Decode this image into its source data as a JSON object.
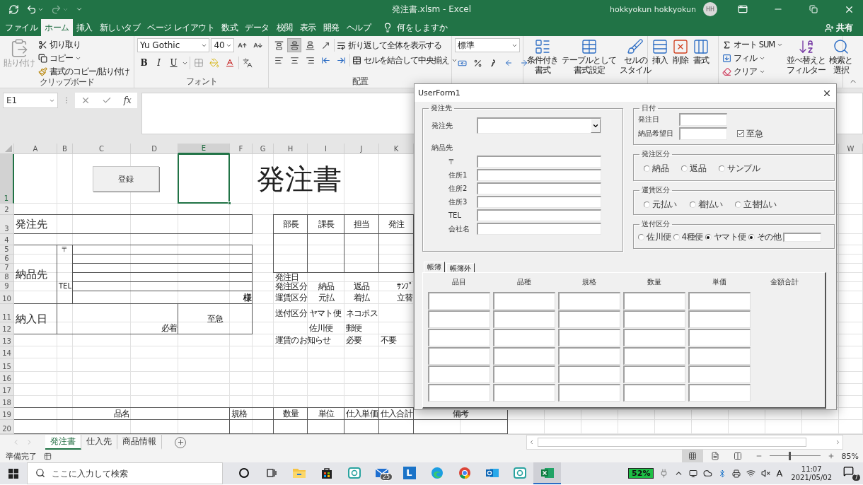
{
  "title_bar": {
    "title": "発注書.xlsm - Excel",
    "user": "hokkyokun hokkyokun",
    "avatar": "HH"
  },
  "tabs": [
    {
      "label": "ファイル",
      "selected": false
    },
    {
      "label": "ホーム",
      "selected": true
    },
    {
      "label": "挿入",
      "selected": false
    },
    {
      "label": "新しいタブ",
      "selected": false
    },
    {
      "label": "ページ レイアウト",
      "selected": false
    },
    {
      "label": "数式",
      "selected": false
    },
    {
      "label": "データ",
      "selected": false
    },
    {
      "label": "校閲",
      "selected": false
    },
    {
      "label": "表示",
      "selected": false
    },
    {
      "label": "開発",
      "selected": false
    },
    {
      "label": "ヘルプ",
      "selected": false
    }
  ],
  "tell_me": "何をしますか",
  "share": "共有",
  "ribbon": {
    "clipboard": {
      "label": "クリップボード",
      "paste": {
        "label": "貼り付け",
        "disabled": true
      },
      "cut": "切り取り",
      "copy": "コピー",
      "format_painter": "書式のコピー/貼り付け"
    },
    "font": {
      "label": "フォント",
      "font_name": "Yu Gothic",
      "font_size": "40",
      "bold": "B",
      "italic": "I",
      "underline": "U"
    },
    "alignment": {
      "label": "配置",
      "vertical": [
        {
          "selected": false
        },
        {
          "selected": true
        },
        {
          "selected": false
        }
      ],
      "wrap_text": "折り返して全体を表示する",
      "merge": "セルを結合して中央揃え"
    },
    "number": {
      "format": "標準"
    },
    "styles": [
      {
        "lines": [
          "条件付き",
          "書式"
        ]
      },
      {
        "lines": [
          "テーブルとして",
          "書式設定"
        ]
      },
      {
        "lines": [
          "セルの",
          "スタイル"
        ]
      }
    ],
    "cells": [
      "挿入",
      "削除",
      "書式"
    ],
    "editing": {
      "autosum": "オート SUM",
      "fill": "フィル",
      "clear": "クリア",
      "sort": [
        "並べ替えと",
        "フィルター"
      ],
      "find": [
        "検索と",
        "選択"
      ]
    }
  },
  "formula_bar": {
    "name_box": "E1",
    "function_label": "fx"
  },
  "sheet": {
    "columns": [
      {
        "label": "A",
        "selected": false
      },
      {
        "label": "B",
        "selected": false
      },
      {
        "label": "C",
        "selected": false
      },
      {
        "label": "D",
        "selected": false
      },
      {
        "label": "E",
        "selected": true
      },
      {
        "label": "F",
        "selected": false
      },
      {
        "label": "G",
        "selected": false
      },
      {
        "label": "H",
        "selected": false
      },
      {
        "label": "I",
        "selected": false
      },
      {
        "label": "J",
        "selected": false
      },
      {
        "label": "K",
        "selected": false
      },
      {
        "label": "W",
        "selected": false
      }
    ],
    "rows": [
      {
        "label": "1",
        "selected": true
      },
      {
        "label": "2",
        "selected": false
      },
      {
        "label": "3",
        "selected": false
      },
      {
        "label": "4",
        "selected": false
      },
      {
        "label": "5",
        "selected": false
      },
      {
        "label": "6",
        "selected": false
      },
      {
        "label": "7",
        "selected": false
      },
      {
        "label": "8",
        "selected": false
      },
      {
        "label": "9",
        "selected": false
      },
      {
        "label": "10",
        "selected": false
      },
      {
        "label": "11",
        "selected": false
      },
      {
        "label": "12",
        "selected": false
      },
      {
        "label": "13",
        "selected": false
      },
      {
        "label": "14",
        "selected": false
      },
      {
        "label": "15",
        "selected": false
      },
      {
        "label": "16",
        "selected": false
      },
      {
        "label": "17",
        "selected": false
      },
      {
        "label": "18",
        "selected": false
      },
      {
        "label": "19",
        "selected": false
      },
      {
        "label": "20",
        "selected": false
      }
    ],
    "sheet_button": "登録",
    "cells": [
      {
        "text": "発注書",
        "kind": "title"
      },
      {
        "text": "発注先",
        "kind": "large"
      },
      {
        "text": "部長",
        "kind": "normal"
      },
      {
        "text": "課長",
        "kind": "normal"
      },
      {
        "text": "担当",
        "kind": "normal"
      },
      {
        "text": "発注",
        "kind": "normal"
      },
      {
        "text": "〒",
        "kind": "small"
      },
      {
        "text": "納品先",
        "kind": "large"
      },
      {
        "text": "発注日",
        "kind": "normal"
      },
      {
        "text": "TEL",
        "kind": "small"
      },
      {
        "text": "発注区分",
        "kind": "normal"
      },
      {
        "text": "納品",
        "kind": "normal"
      },
      {
        "text": "返品",
        "kind": "normal"
      },
      {
        "text": "ｻﾝﾌﾟ",
        "kind": "normal"
      },
      {
        "text": "様",
        "kind": "bold"
      },
      {
        "text": "運賃区分",
        "kind": "normal"
      },
      {
        "text": "元払",
        "kind": "normal"
      },
      {
        "text": "着払",
        "kind": "normal"
      },
      {
        "text": "立替",
        "kind": "normal"
      },
      {
        "text": "納入日",
        "kind": "large"
      },
      {
        "text": "至急",
        "kind": "normal"
      },
      {
        "text": "送付区分",
        "kind": "normal"
      },
      {
        "text": "ヤマト便",
        "kind": "normal"
      },
      {
        "text": "ネコポス",
        "kind": "normal"
      },
      {
        "text": "必着",
        "kind": "normal"
      },
      {
        "text": "佐川便",
        "kind": "normal"
      },
      {
        "text": "郵便",
        "kind": "normal"
      },
      {
        "text": "運賃のお知らせ",
        "kind": "normal"
      },
      {
        "text": "必要",
        "kind": "normal"
      },
      {
        "text": "不要",
        "kind": "normal"
      },
      {
        "text": "品名",
        "kind": "normal"
      },
      {
        "text": "規格",
        "kind": "normal"
      },
      {
        "text": "数量",
        "kind": "normal"
      },
      {
        "text": "単位",
        "kind": "normal"
      },
      {
        "text": "仕入単価",
        "kind": "normal"
      },
      {
        "text": "仕入合計",
        "kind": "normal"
      },
      {
        "text": "備考",
        "kind": "normal"
      }
    ]
  },
  "sheet_tabs": [
    {
      "label": "発注書",
      "selected": true
    },
    {
      "label": "仕入先",
      "selected": false
    },
    {
      "label": "商品情報",
      "selected": false
    }
  ],
  "status_bar": {
    "text": "準備完了",
    "views": [
      {
        "selected": true
      },
      {
        "selected": false
      },
      {
        "selected": false
      }
    ],
    "zoom_slider": {
      "level": 0.4
    },
    "zoom": "85%"
  },
  "user_form": {
    "title": "UserForm1",
    "order_frame": {
      "caption": "発注先",
      "supplier_label": "発注先",
      "delivery_label": "納品先",
      "fields": [
        {
          "label": "〒"
        },
        {
          "label": "住所1"
        },
        {
          "label": "住所2"
        },
        {
          "label": "住所3"
        },
        {
          "label": "TEL"
        },
        {
          "label": "会社名"
        }
      ]
    },
    "date_frame": {
      "caption": "日付",
      "fields": [
        {
          "label": "発注日"
        },
        {
          "label": "納品希望日"
        }
      ],
      "urgent": {
        "label": "至急",
        "checked": true
      }
    },
    "option_frames": [
      {
        "caption": "発注区分",
        "with_field": false,
        "options": [
          {
            "label": "納品",
            "selected": false
          },
          {
            "label": "返品",
            "selected": false
          },
          {
            "label": "サンプル",
            "selected": false
          }
        ]
      },
      {
        "caption": "運賃区分",
        "with_field": false,
        "options": [
          {
            "label": "元払い",
            "selected": false
          },
          {
            "label": "着払い",
            "selected": false
          },
          {
            "label": "立替払い",
            "selected": false
          }
        ]
      },
      {
        "caption": "送付区分",
        "with_field": true,
        "options": [
          {
            "label": "佐川便",
            "selected": false
          },
          {
            "label": "4種便",
            "selected": false
          },
          {
            "label": "ヤマト便",
            "selected": true
          },
          {
            "label": "その他",
            "selected": true
          }
        ]
      }
    ],
    "tabs": [
      {
        "label": "帳簿",
        "selected": true
      },
      {
        "label": "帳簿外",
        "selected": false
      }
    ],
    "grid_columns": [
      {
        "label": "品目",
        "kind": "input"
      },
      {
        "label": "品種",
        "kind": "input"
      },
      {
        "label": "規格",
        "kind": "input"
      },
      {
        "label": "数量",
        "kind": "input"
      },
      {
        "label": "単価",
        "kind": "input"
      },
      {
        "label": "金額合計",
        "kind": "total"
      }
    ]
  },
  "taskbar": {
    "search_placeholder": "ここに入力して検索",
    "apps": [
      {
        "kind": "cortana",
        "active": false
      },
      {
        "kind": "task_view",
        "active": false
      },
      {
        "kind": "explorer",
        "active": false
      },
      {
        "kind": "store",
        "active": false
      },
      {
        "kind": "teal_app",
        "active": false
      },
      {
        "kind": "mail",
        "badge": "25",
        "active": false
      },
      {
        "kind": "letter_app",
        "label": "L",
        "active": false
      },
      {
        "kind": "edge",
        "active": false
      },
      {
        "kind": "chrome",
        "active": false
      },
      {
        "kind": "outlook",
        "active": false
      },
      {
        "kind": "teal_app",
        "active": false
      },
      {
        "kind": "excel",
        "active": true
      }
    ],
    "battery": "52%",
    "ime": "A",
    "time": "11:07",
    "date": "2021/05/02",
    "notifications": "7"
  }
}
